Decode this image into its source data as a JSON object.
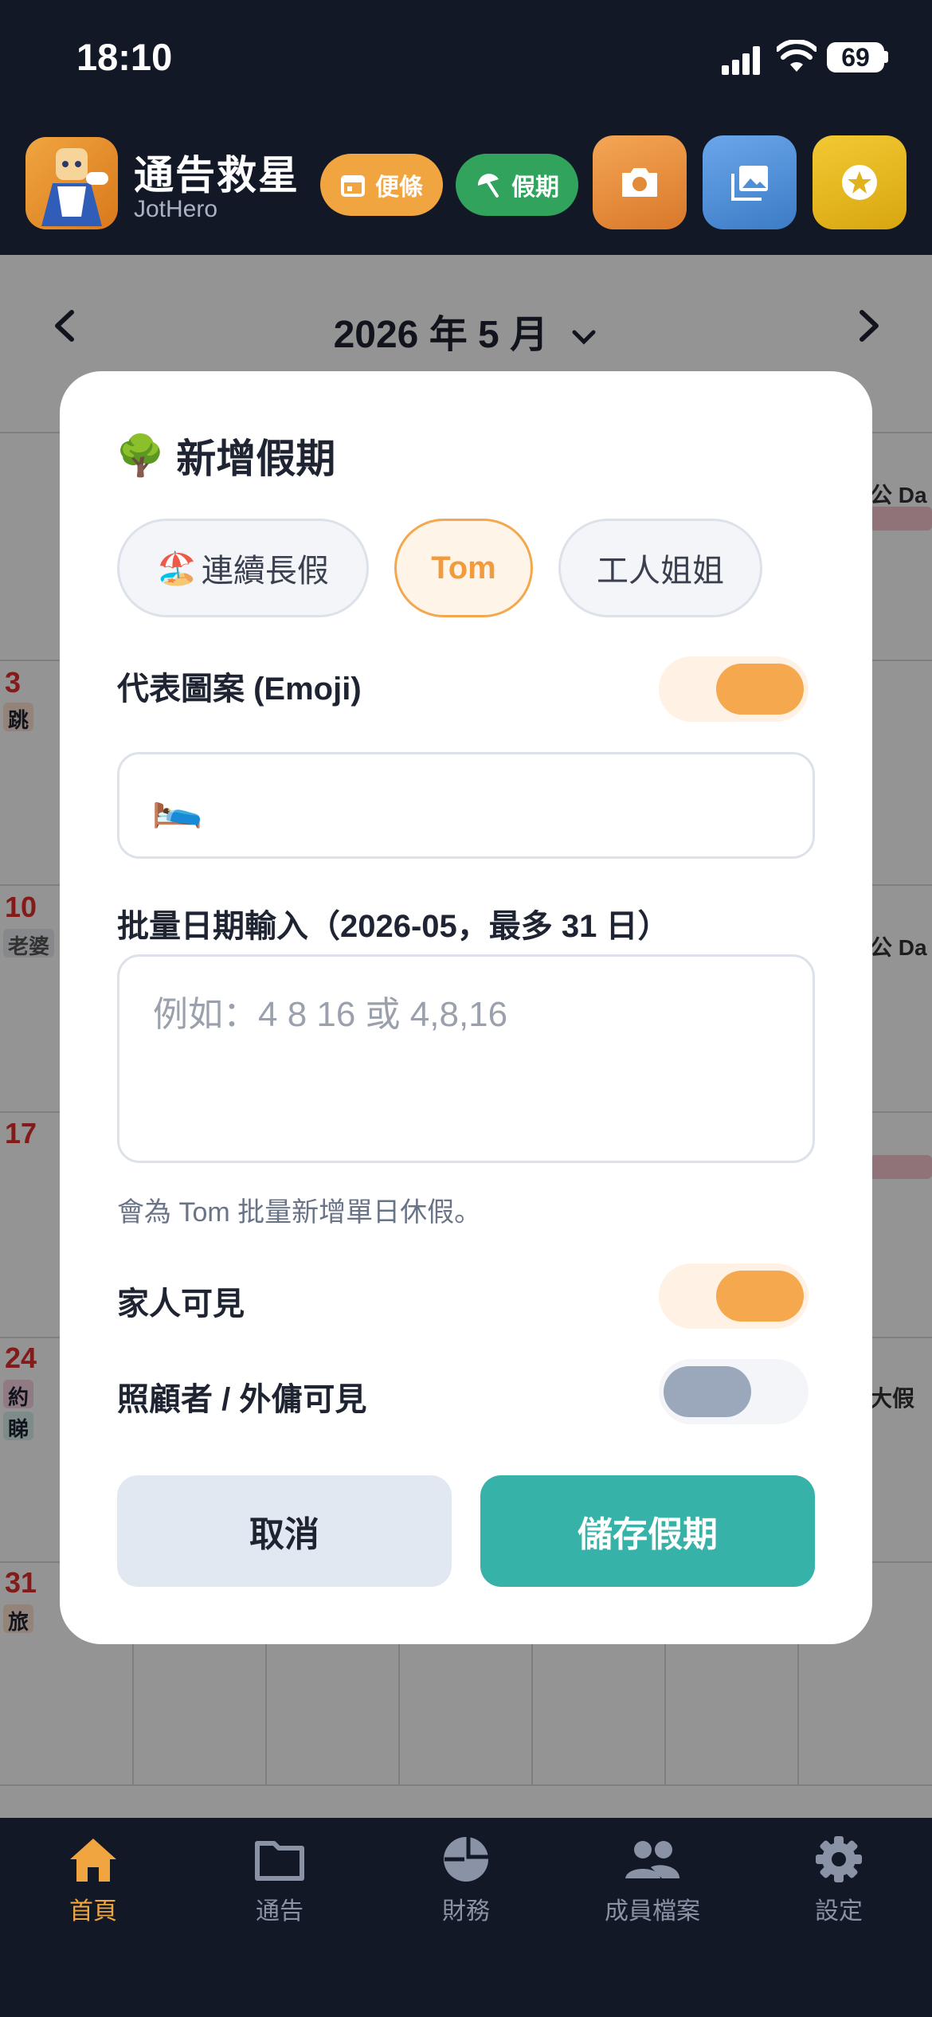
{
  "status_bar": {
    "time": "18:10",
    "battery": "69"
  },
  "header": {
    "app_title": "通告救星",
    "app_subtitle": "JotHero",
    "notes_label": "便條",
    "holiday_label": "假期"
  },
  "calendar": {
    "month_title": "2026 年 5 月",
    "day_numbers": [
      "3",
      "10",
      "17",
      "24",
      "31"
    ],
    "chips": {
      "row1": "跳",
      "row2": "老婆",
      "row4a": "約",
      "row4b": "睇",
      "row5": "旅"
    },
    "right_texts": {
      "r0": "公 Da",
      "r1": "公 Da",
      "r3": "大假"
    }
  },
  "dialog": {
    "title_emoji": "🌳",
    "title": "新增假期",
    "chips": [
      {
        "emoji": "🏖️",
        "label": "連續長假",
        "selected": false
      },
      {
        "label": "Tom",
        "selected": true
      },
      {
        "label": "工人姐姐",
        "selected": false
      }
    ],
    "emoji_toggle_label": "代表圖案 (Emoji)",
    "emoji_toggle_on": true,
    "emoji_value": "🛌",
    "dates_label": "批量日期輸入（2026-05，最多 31 日）",
    "dates_placeholder": "例如：4 8 16 或 4,8,16",
    "hint": "會為 Tom 批量新增單日休假。",
    "family_visible_label": "家人可見",
    "family_visible_on": true,
    "caregiver_visible_label": "照顧者 / 外傭可見",
    "caregiver_visible_on": false,
    "cancel_label": "取消",
    "save_label": "儲存假期"
  },
  "tab_bar": {
    "tabs": [
      {
        "label": "首頁",
        "icon": "home-icon",
        "active": true
      },
      {
        "label": "通告",
        "icon": "folder-icon",
        "active": false
      },
      {
        "label": "財務",
        "icon": "pie-chart-icon",
        "active": false
      },
      {
        "label": "成員檔案",
        "icon": "people-icon",
        "active": false
      },
      {
        "label": "設定",
        "icon": "gear-icon",
        "active": false
      }
    ]
  },
  "colors": {
    "accent_orange": "#f5a84d",
    "teal": "#36b2a8",
    "active_tab": "#f0a540",
    "dark_bg": "#121826"
  }
}
